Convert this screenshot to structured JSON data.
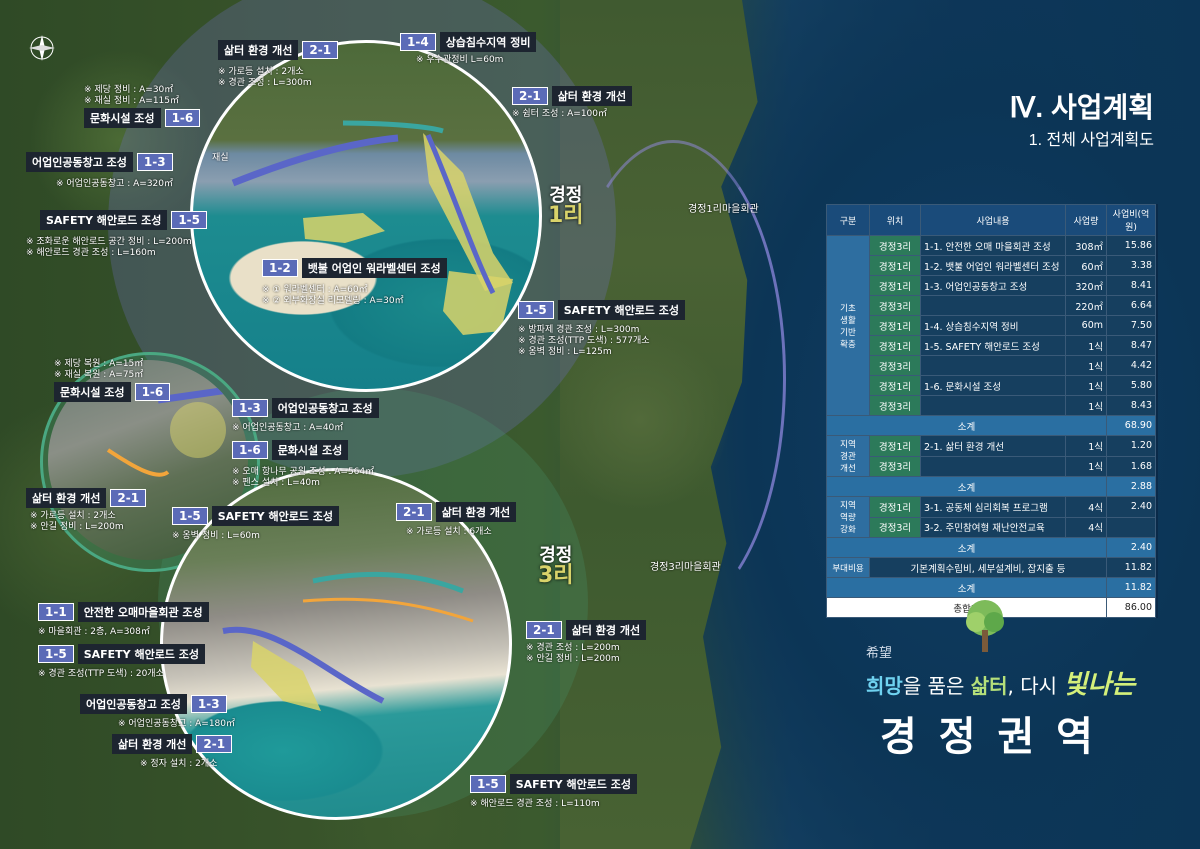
{
  "header": {
    "chapter": "Ⅳ. 사업계획",
    "subtitle": "1. 전체 사업계획도"
  },
  "map_labels": {
    "village_1": "경정\n1리",
    "village_1_line1": "경정",
    "village_1_line2": "1리",
    "village_3_line1": "경정",
    "village_3_line2": "3리",
    "hall_1": "경정1리마을회관",
    "hall_3": "경정3리마을회관",
    "small_bldg": "재실"
  },
  "callouts": [
    {
      "code": "2-1",
      "label": "삶터 환경 개선",
      "notes": [
        "※ 가로등 설치 : 2개소",
        "※ 경관 조성 : L=300m"
      ]
    },
    {
      "code": "1-4",
      "label": "상습침수지역 정비",
      "notes": [
        "※ 우수관정비 L=60m"
      ]
    },
    {
      "code": "2-1",
      "label": "삶터 환경 개선",
      "notes": [
        "※ 쉼터 조성 : A=100㎡"
      ]
    },
    {
      "code": "1-6",
      "label": "문화시설 조성",
      "notes": [
        "※ 제당 정비 : A=30㎡",
        "※ 재실 정비 : A=115㎡"
      ]
    },
    {
      "code": "1-3",
      "label": "어업인공동창고 조성",
      "notes": [
        "※ 어업인공동창고 : A=320㎡"
      ]
    },
    {
      "code": "1-5",
      "label": "SAFETY 해안로드 조성",
      "notes": [
        "※ 조화로운 해안로드 공간 정비 : L=200m",
        "※ 해안로드 경관 조성 : L=160m"
      ]
    },
    {
      "code": "1-2",
      "label": "뱃불 어업인 워라벨센터 조성",
      "notes": [
        "※ ① 워라벨센터 : A=60㎡",
        "※ ② 외부화장실 리모델링 : A=30㎡"
      ]
    },
    {
      "code": "1-5",
      "label": "SAFETY 해안로드 조성",
      "notes": [
        "※ 방파제 경관 조성 : L=300m",
        "※ 경관 조성(TTP 도색) : 577개소",
        "※ 옹벽 정비 : L=125m"
      ]
    },
    {
      "code": "1-6",
      "label": "문화시설 조성",
      "notes": [
        "※ 제당 복원 : A=15㎡",
        "※ 재실 복원 : A=75㎡"
      ]
    },
    {
      "code": "1-3",
      "label": "어업인공동창고 조성",
      "notes": [
        "※ 어업인공동창고 : A=40㎡"
      ]
    },
    {
      "code": "1-6",
      "label": "문화시설 조성",
      "notes": [
        "※ 오매 항나무 공원 조성 : A=564㎡",
        "※ 펜스 설치 : L=40m"
      ]
    },
    {
      "code": "2-1",
      "label": "삶터 환경 개선",
      "notes": [
        "※ 가로등 설치 : 2개소",
        "※ 안길 정비 : L=200m"
      ]
    },
    {
      "code": "1-5",
      "label": "SAFETY 해안로드 조성",
      "notes": [
        "※ 옹벽 정비 : L=60m"
      ]
    },
    {
      "code": "2-1",
      "label": "삶터 환경 개선",
      "notes": [
        "※ 가로등 설치 : 6개소"
      ]
    },
    {
      "code": "1-1",
      "label": "안전한 오매마을회관 조성",
      "notes": [
        "※ 마을회관 : 2층, A=308㎡"
      ]
    },
    {
      "code": "1-5",
      "label": "SAFETY 해안로드 조성",
      "notes": [
        "※ 경관 조성(TTP 도색) : 20개소"
      ]
    },
    {
      "code": "2-1",
      "label": "삶터 환경 개선",
      "notes": [
        "※ 경관 조성 : L=200m",
        "※ 안길 정비 : L=200m"
      ]
    },
    {
      "code": "1-3",
      "label": "어업인공동창고 조성",
      "notes": [
        "※ 어업인공동창고 : A=180㎡"
      ]
    },
    {
      "code": "2-1",
      "label": "삶터 환경 개선",
      "notes": [
        "※ 정자 설치 : 2개소"
      ]
    },
    {
      "code": "1-5",
      "label": "SAFETY 해안로드 조성",
      "notes": [
        "※ 해안로드 경관 조성 : L=110m"
      ]
    }
  ],
  "table": {
    "headers": [
      "구분",
      "위치",
      "사업내용",
      "사업량",
      "사업비(억원)"
    ],
    "groups": [
      {
        "name": "기초\n생활\n기반\n확충",
        "rows": [
          {
            "loc": "경정3리",
            "content": "1-1. 안전한 오매 마을회관 조성",
            "qty": "308㎡",
            "cost": "15.86"
          },
          {
            "loc": "경정1리",
            "content": "1-2. 뱃불 어업인 워라벨센터 조성",
            "qty": "60㎡",
            "cost": "3.38"
          },
          {
            "loc": "경정1리",
            "content": "1-3. 어업인공동창고 조성",
            "qty": "320㎡",
            "cost": "8.41"
          },
          {
            "loc": "경정3리",
            "content": "",
            "qty": "220㎡",
            "cost": "6.64"
          },
          {
            "loc": "경정1리",
            "content": "1-4. 상습침수지역 정비",
            "qty": "60m",
            "cost": "7.50"
          },
          {
            "loc": "경정1리",
            "content": "1-5. SAFETY 해안로드 조성",
            "qty": "1식",
            "cost": "8.47"
          },
          {
            "loc": "경정3리",
            "content": "",
            "qty": "1식",
            "cost": "4.42"
          },
          {
            "loc": "경정1리",
            "content": "1-6. 문화시설 조성",
            "qty": "1식",
            "cost": "5.80"
          },
          {
            "loc": "경정3리",
            "content": "",
            "qty": "1식",
            "cost": "8.43"
          }
        ],
        "subtotal_label": "소계",
        "subtotal": "68.90"
      },
      {
        "name": "지역\n경관\n개선",
        "rows": [
          {
            "loc": "경정1리",
            "content": "2-1. 삶터 환경 개선",
            "qty": "1식",
            "cost": "1.20"
          },
          {
            "loc": "경정3리",
            "content": "",
            "qty": "1식",
            "cost": "1.68"
          }
        ],
        "subtotal_label": "소계",
        "subtotal": "2.88"
      },
      {
        "name": "지역\n역량\n강화",
        "rows": [
          {
            "loc": "경정1리",
            "content": "3-1. 공동체 심리회복 프로그램",
            "qty": "4식",
            "cost": "2.40"
          },
          {
            "loc": "경정3리",
            "content": "3-2. 주민참여형 재난안전교육",
            "qty": "4식",
            "cost": ""
          }
        ],
        "subtotal_label": "소계",
        "subtotal": "2.40"
      }
    ],
    "extra": {
      "name": "부대비용",
      "content": "기본계획수립비, 세부설계비, 잡지출 등",
      "cost": "11.82",
      "subtotal_label": "소계",
      "subtotal": "11.82"
    },
    "total_label": "총합계",
    "total": "86.00"
  },
  "slogan": {
    "small": "希望",
    "part1": "희망",
    "part2": "을 품은 ",
    "part3": "삶터",
    "part4": ", 다시 ",
    "part5": "빛나는",
    "title": "경 정 권 역"
  },
  "colors": {
    "code_badge": "#5b6bb7",
    "label_bg": "#1d2530",
    "village_tag": "#2c7a5a",
    "sea": "#0c3556",
    "accent_yellow": "#f2d34b"
  }
}
